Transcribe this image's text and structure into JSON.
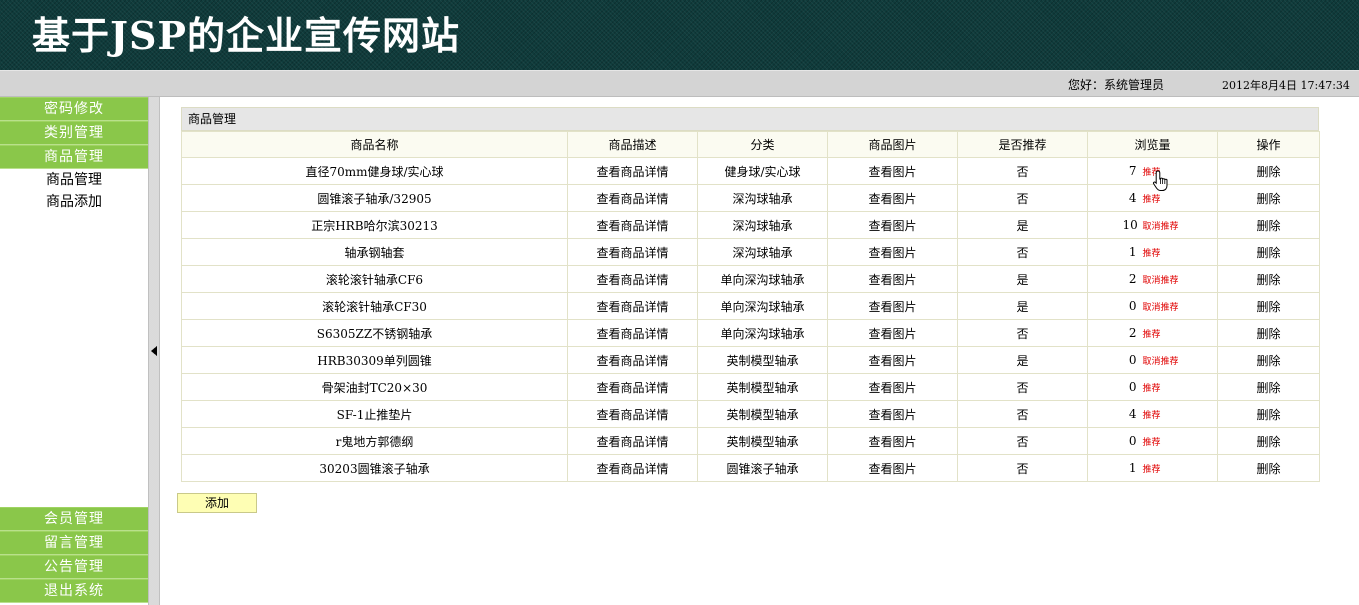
{
  "header": {
    "title": "基于JSP的企业宣传网站"
  },
  "status": {
    "greeting": "您好：系统管理员",
    "datetime": "2012年8月4日  17:47:34"
  },
  "sidebar": {
    "top_items": [
      {
        "label": "密码修改"
      },
      {
        "label": "类别管理"
      },
      {
        "label": "商品管理"
      }
    ],
    "sub_items": [
      {
        "label": "商品管理"
      },
      {
        "label": "商品添加"
      }
    ],
    "bottom_items": [
      {
        "label": "会员管理"
      },
      {
        "label": "留言管理"
      },
      {
        "label": "公告管理"
      },
      {
        "label": "退出系统"
      }
    ]
  },
  "panel": {
    "title": "商品管理",
    "columns": [
      "商品名称",
      "商品描述",
      "分类",
      "商品图片",
      "是否推荐",
      "浏览量",
      "操作"
    ],
    "rows": [
      {
        "name": "直径70mm健身球/实心球",
        "desc": "查看商品详情",
        "category": "健身球/实心球",
        "image": "查看图片",
        "recommended": "否",
        "views": "7",
        "rec_action": "推荐",
        "op": "删除"
      },
      {
        "name": "圆锥滚子轴承/32905",
        "desc": "查看商品详情",
        "category": "深沟球轴承",
        "image": "查看图片",
        "recommended": "否",
        "views": "4",
        "rec_action": "推荐",
        "op": "删除"
      },
      {
        "name": "正宗HRB哈尔滨30213",
        "desc": "查看商品详情",
        "category": "深沟球轴承",
        "image": "查看图片",
        "recommended": "是",
        "views": "10",
        "rec_action": "取消推荐",
        "op": "删除"
      },
      {
        "name": "轴承钢轴套",
        "desc": "查看商品详情",
        "category": "深沟球轴承",
        "image": "查看图片",
        "recommended": "否",
        "views": "1",
        "rec_action": "推荐",
        "op": "删除"
      },
      {
        "name": "滚轮滚针轴承CF6",
        "desc": "查看商品详情",
        "category": "单向深沟球轴承",
        "image": "查看图片",
        "recommended": "是",
        "views": "2",
        "rec_action": "取消推荐",
        "op": "删除"
      },
      {
        "name": "滚轮滚针轴承CF30",
        "desc": "查看商品详情",
        "category": "单向深沟球轴承",
        "image": "查看图片",
        "recommended": "是",
        "views": "0",
        "rec_action": "取消推荐",
        "op": "删除"
      },
      {
        "name": "S6305ZZ不锈钢轴承",
        "desc": "查看商品详情",
        "category": "单向深沟球轴承",
        "image": "查看图片",
        "recommended": "否",
        "views": "2",
        "rec_action": "推荐",
        "op": "删除"
      },
      {
        "name": "HRB30309单列圆锥",
        "desc": "查看商品详情",
        "category": "英制模型轴承",
        "image": "查看图片",
        "recommended": "是",
        "views": "0",
        "rec_action": "取消推荐",
        "op": "删除"
      },
      {
        "name": "骨架油封TC20×30",
        "desc": "查看商品详情",
        "category": "英制模型轴承",
        "image": "查看图片",
        "recommended": "否",
        "views": "0",
        "rec_action": "推荐",
        "op": "删除"
      },
      {
        "name": "SF-1止推垫片",
        "desc": "查看商品详情",
        "category": "英制模型轴承",
        "image": "查看图片",
        "recommended": "否",
        "views": "4",
        "rec_action": "推荐",
        "op": "删除"
      },
      {
        "name": "r鬼地方郭德纲",
        "desc": "查看商品详情",
        "category": "英制模型轴承",
        "image": "查看图片",
        "recommended": "否",
        "views": "0",
        "rec_action": "推荐",
        "op": "删除"
      },
      {
        "name": "30203圆锥滚子轴承",
        "desc": "查看商品详情",
        "category": "圆锥滚子轴承",
        "image": "查看图片",
        "recommended": "否",
        "views": "1",
        "rec_action": "推荐",
        "op": "删除"
      }
    ]
  },
  "actions": {
    "add_label": "添加"
  }
}
